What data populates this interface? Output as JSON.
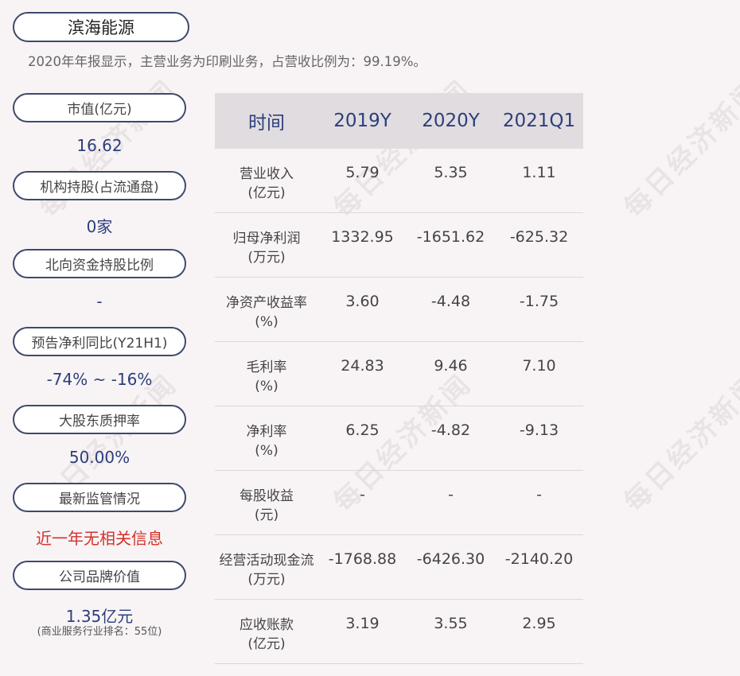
{
  "company": "滨海能源",
  "summary": "2020年年报显示，主营业务为印刷业务，占营收比例为：99.19%。",
  "watermark": "每日经济新闻",
  "metrics": [
    {
      "label": "市值(亿元)",
      "value": "16.62"
    },
    {
      "label": "机构持股(占流通盘)",
      "value": "0家"
    },
    {
      "label": "北向资金持股比例",
      "value": "-"
    },
    {
      "label": "预告净利同比(Y21H1)",
      "value": "-74% ~ -16%"
    },
    {
      "label": "大股东质押率",
      "value": "50.00%"
    },
    {
      "label": "最新监管情况",
      "value": "近一年无相关信息"
    },
    {
      "label": "公司品牌价值",
      "value": "1.35亿元",
      "note": "(商业服务行业排名：55位)"
    }
  ],
  "table": {
    "headers": [
      "时间",
      "2019Y",
      "2020Y",
      "2021Q1"
    ],
    "rows": [
      {
        "label1": "营业收入",
        "label2": "(亿元)",
        "v": [
          "5.79",
          "5.35",
          "1.11"
        ]
      },
      {
        "label1": "归母净利润",
        "label2": "(万元)",
        "v": [
          "1332.95",
          "-1651.62",
          "-625.32"
        ]
      },
      {
        "label1": "净资产收益率",
        "label2": "(%)",
        "v": [
          "3.60",
          "-4.48",
          "-1.75"
        ]
      },
      {
        "label1": "毛利率",
        "label2": "(%)",
        "v": [
          "24.83",
          "9.46",
          "7.10"
        ]
      },
      {
        "label1": "净利率",
        "label2": "(%)",
        "v": [
          "6.25",
          "-4.82",
          "-9.13"
        ]
      },
      {
        "label1": "每股收益",
        "label2": "(元)",
        "v": [
          "-",
          "-",
          "-"
        ]
      },
      {
        "label1": "经营活动现金流",
        "label2": "(万元)",
        "v": [
          "-1768.88",
          "-6426.30",
          "-2140.20"
        ]
      },
      {
        "label1": "应收账款",
        "label2": "(亿元)",
        "v": [
          "3.19",
          "3.55",
          "2.95"
        ]
      }
    ]
  },
  "colors": {
    "accent": "#2c3f7c",
    "alert": "#d6302a",
    "border": "#3e4a6b",
    "background": "#f8f4f5"
  }
}
